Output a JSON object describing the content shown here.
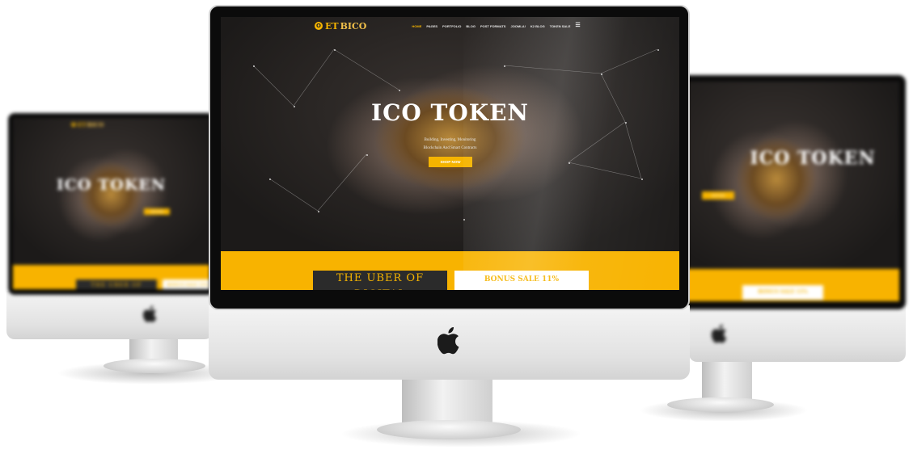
{
  "site": {
    "logo": {
      "coin": "O",
      "part1": "ET",
      "part2": "BICO"
    },
    "menu": [
      "HOME",
      "PAGES",
      "PORTFOLIO",
      "BLOG",
      "POST FORMATS",
      "JOOMLA!",
      "K2 BLOG",
      "TOKEN SALE"
    ],
    "menu_icon": "hamburger-icon",
    "hero": {
      "title": "ICO TOKEN",
      "subtitle_line1": "Building, Investing, Monitoring",
      "subtitle_line2": "Blockchain And Smart Contracts",
      "button": "SHOP NOW"
    },
    "band": {
      "dark_box": "THE UBER OF DIGITAL",
      "white_box": "BONUS SALE 11%"
    },
    "colors": {
      "accent": "#f5b400",
      "dark": "#2b2b2b"
    }
  },
  "device": {
    "brand_icon": "apple-logo-icon"
  }
}
